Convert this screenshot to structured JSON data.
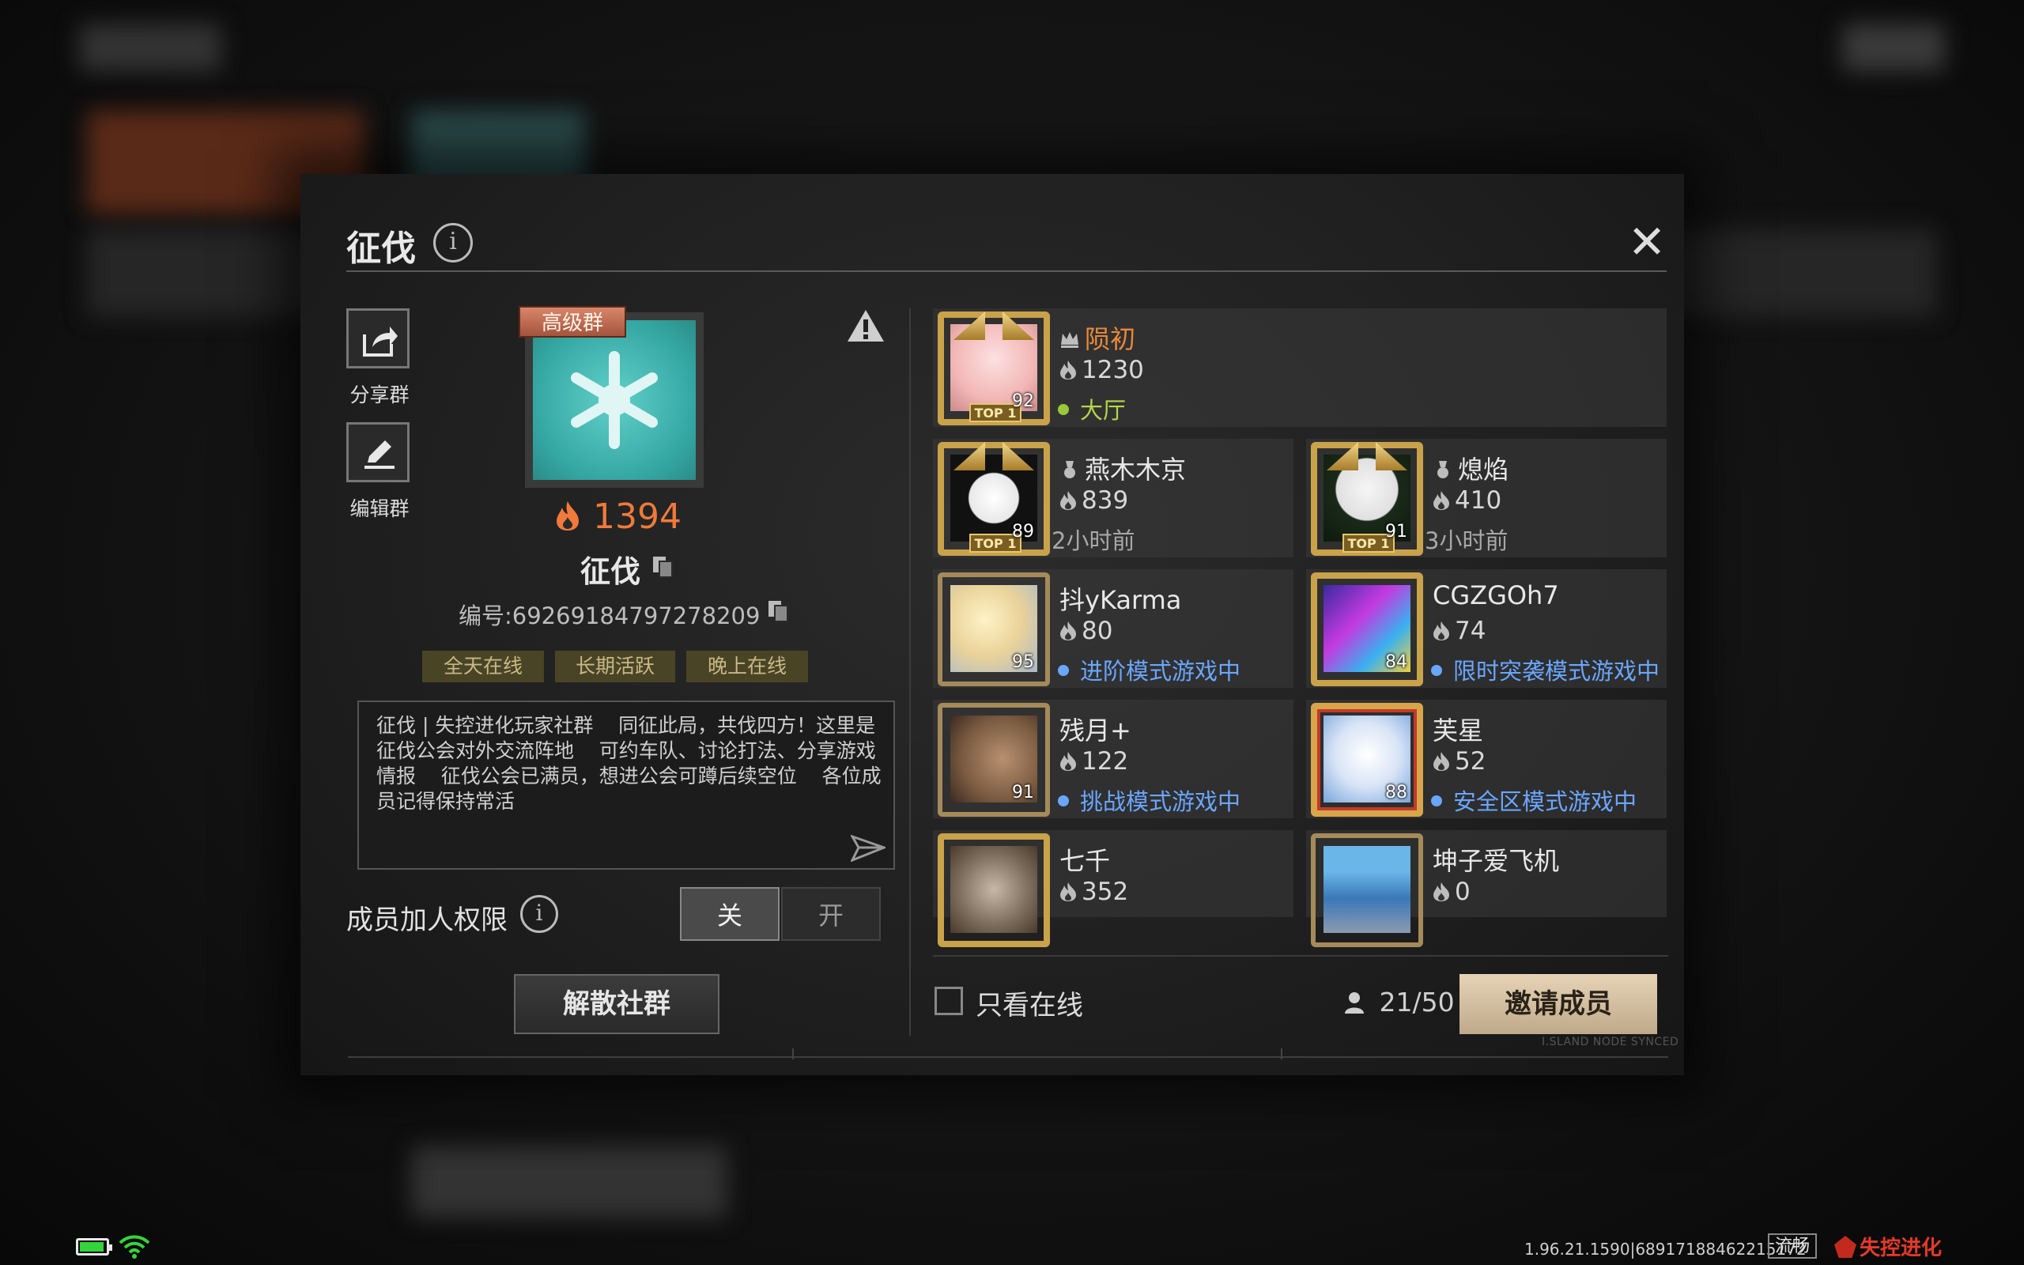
{
  "header": {
    "title": "征伐",
    "close_symbol": "✕"
  },
  "side_actions": [
    {
      "label": "分享群",
      "icon": "share-icon"
    },
    {
      "label": "编辑群",
      "icon": "edit-icon"
    }
  ],
  "group": {
    "premium_tag": "高级群",
    "score": "1394",
    "name": "征伐",
    "id_text": "编号:69269184797278209",
    "tags": [
      "全天在线",
      "长期活跃",
      "晚上在线"
    ],
    "description": "征伐 | 失控进化玩家社群    同征此局，共伐四方！这里是征伐公会对外交流阵地    可约车队、讨论打法、分享游戏情报    征伐公会已满员，想进公会可蹲后续空位    各位成员记得保持常活"
  },
  "permission": {
    "label": "成员加人权限",
    "off_label": "关",
    "on_label": "开",
    "selected": "关"
  },
  "disband_label": "解散社群",
  "members": [
    {
      "name": "陨初",
      "score": "1230",
      "level": "92",
      "status": "大厅",
      "status_type": "lobby",
      "rank": "crown-icon",
      "top1": "TOP 1"
    },
    {
      "name": "燕木木京",
      "score": "839",
      "level": "89",
      "status": "2小时前",
      "status_type": "time",
      "rank": "medal-icon",
      "top1": "TOP 1"
    },
    {
      "name": "熄焰",
      "score": "410",
      "level": "91",
      "status": "3小时前",
      "status_type": "time",
      "rank": "medal-icon",
      "top1": "TOP 1"
    },
    {
      "name": "抖yKarma",
      "score": "80",
      "level": "95",
      "status": "进阶模式游戏中",
      "status_type": "game"
    },
    {
      "name": "CGZGOh7",
      "score": "74",
      "level": "84",
      "status": "限时突袭模式游戏中",
      "status_type": "game"
    },
    {
      "name": "残月+",
      "score": "122",
      "level": "91",
      "status": "挑战模式游戏中",
      "status_type": "game"
    },
    {
      "name": "芙星",
      "score": "52",
      "level": "88",
      "status": "安全区模式游戏中",
      "status_type": "game"
    },
    {
      "name": "七千",
      "score": "352"
    },
    {
      "name": "坤子爱飞机",
      "score": "0"
    }
  ],
  "footer": {
    "online_only_label": "只看在线",
    "member_count": "21/50",
    "invite_label": "邀请成员",
    "synced_text": "I.SLAND NODE SYNCED"
  },
  "status_bar": {
    "version": "1.96.21.1590|68917188462215172",
    "fluency": "流畅",
    "logo": "失控进化"
  },
  "colors": {
    "accent_orange": "#f07a3a",
    "online_green": "#9bc83a",
    "ingame_blue": "#6aa6ff",
    "invite_bg": "#d8c4a4"
  }
}
